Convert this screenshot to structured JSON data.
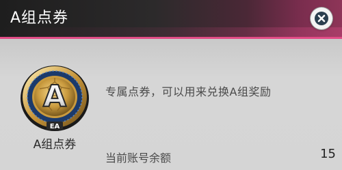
{
  "dialog": {
    "title": "A组点券",
    "close_icon": "close-icon"
  },
  "coin": {
    "icon": "coupon-coin-icon",
    "letter": "A",
    "brand": "EA",
    "label": "A组点券"
  },
  "description": "专属点券，可以用来兑换A组奖励",
  "balance": {
    "label": "当前账号余额",
    "value": "15"
  },
  "colors": {
    "header_dark": "#1e1e1e",
    "header_accent": "#8e3558",
    "accent_line": "#e24c86",
    "body_bg": "#d2d2d2",
    "coin_gold": "#d9b25a",
    "coin_blue": "#1b3a6b"
  }
}
